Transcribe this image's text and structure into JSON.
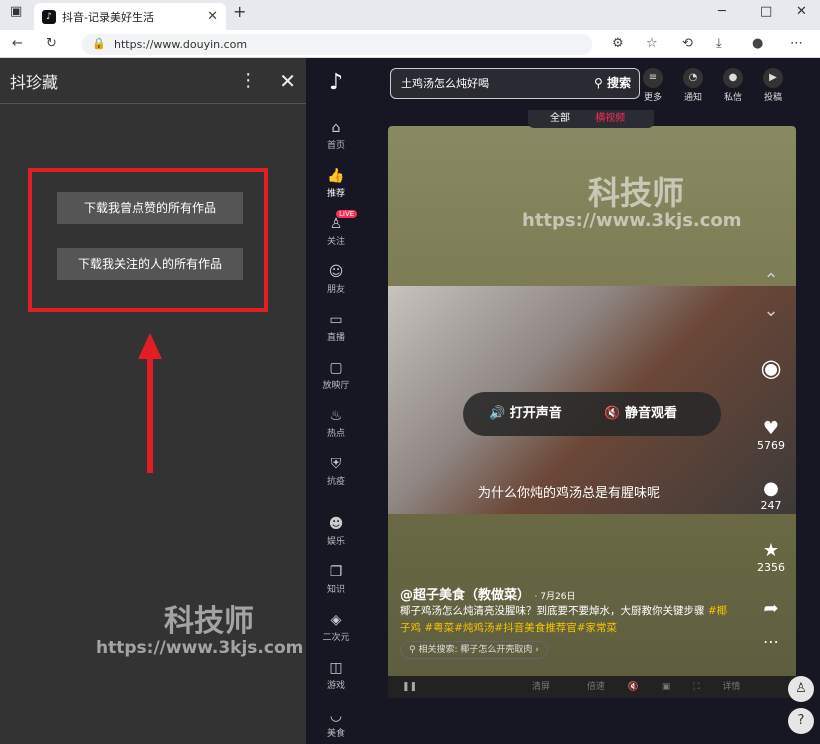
{
  "browser": {
    "tab_title": "抖音-记录美好生活",
    "url": "https://www.douyin.com"
  },
  "panel": {
    "title": "抖珍藏",
    "btn1": "下载我曾点赞的所有作品",
    "btn2": "下载我关注的人的所有作品"
  },
  "watermark": {
    "name": "科技师",
    "url": "https://www.3kjs.com"
  },
  "nav": [
    "首页",
    "推荐",
    "关注",
    "朋友",
    "直播",
    "放映厅",
    "热点",
    "抗疫",
    "娱乐",
    "知识",
    "二次元",
    "游戏",
    "美食"
  ],
  "live_badge": "LIVE",
  "search": {
    "value": "土鸡汤怎么炖好喝",
    "button": "搜索"
  },
  "topicons": [
    "更多",
    "通知",
    "私信",
    "投稿"
  ],
  "tabs": [
    "全部",
    "横视频"
  ],
  "video": {
    "caption": "为什么你炖的鸡汤总是有腥味呢",
    "sound_on": "打开声音",
    "sound_mute": "静音观看",
    "likes": "5769",
    "comments": "247",
    "favorites": "2356",
    "author": "@超子美食（教做菜）",
    "date": "· 7月26日",
    "desc": "椰子鸡汤怎么炖清亮没腥味？到底要不要焯水，大厨教你关键步骤",
    "tags": "#椰子鸡 #粤菜#炖鸡汤#抖音美食推荐官#家常菜",
    "related": "相关搜索: 椰子怎么开壳取肉",
    "ctrl_hd": "清屏",
    "ctrl_speed": "倍速",
    "ctrl_detail": "详情"
  }
}
